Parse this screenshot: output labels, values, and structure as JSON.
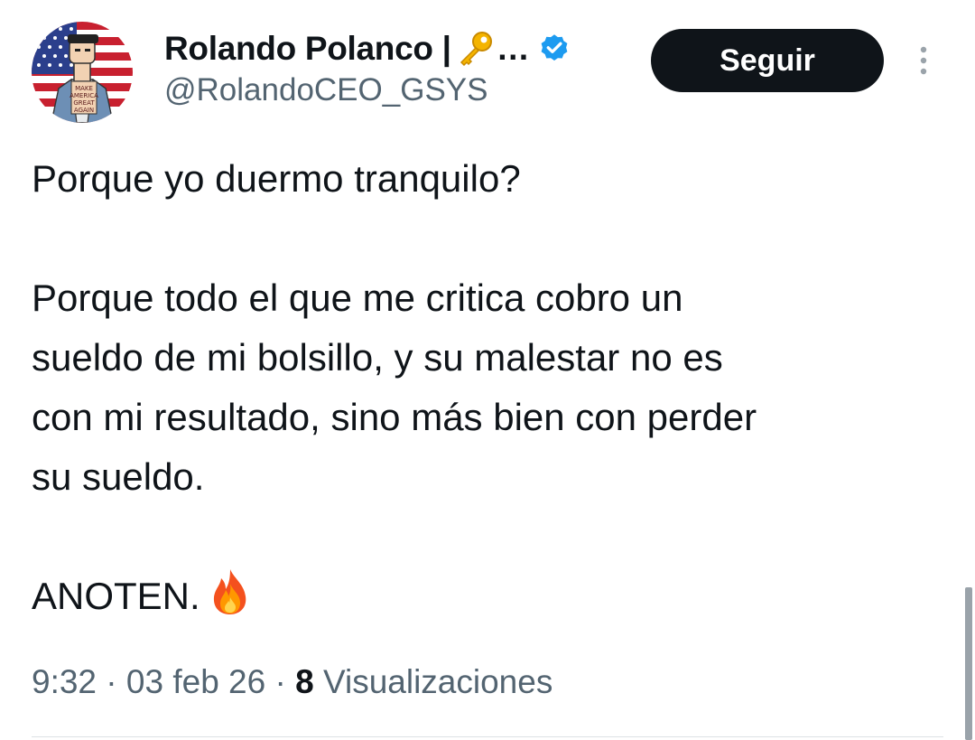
{
  "tweet": {
    "author": {
      "display_name": "Rolando Polanco |",
      "name_emoji": "key-icon",
      "name_ellipsis": "…",
      "handle": "@RolandoCEO_GSYS",
      "verified": true,
      "avatar_text": [
        "MAKE",
        "AMERICA",
        "GREAT",
        "AGAIN"
      ]
    },
    "follow_label": "Seguir",
    "text_lines": {
      "p1": "Porque yo duermo tranquilo?",
      "p2_l1": "Porque todo el que me critica cobro un",
      "p2_l2": "sueldo de mi bolsillo, y su malestar no es",
      "p2_l3": "con mi resultado, sino más bien con perder",
      "p2_l4": "su sueldo.",
      "p3": "ANOTEN."
    },
    "trailing_emoji": "fire-icon",
    "meta": {
      "time": "9:32",
      "sep1": " · ",
      "date": "03 feb 26",
      "sep2": " · ",
      "views_count": "8",
      "views_label": " Visualizaciones"
    }
  },
  "colors": {
    "text_primary": "#0f1419",
    "text_secondary": "#536471",
    "verified_blue": "#1d9bf0",
    "button_bg": "#0f1419"
  }
}
